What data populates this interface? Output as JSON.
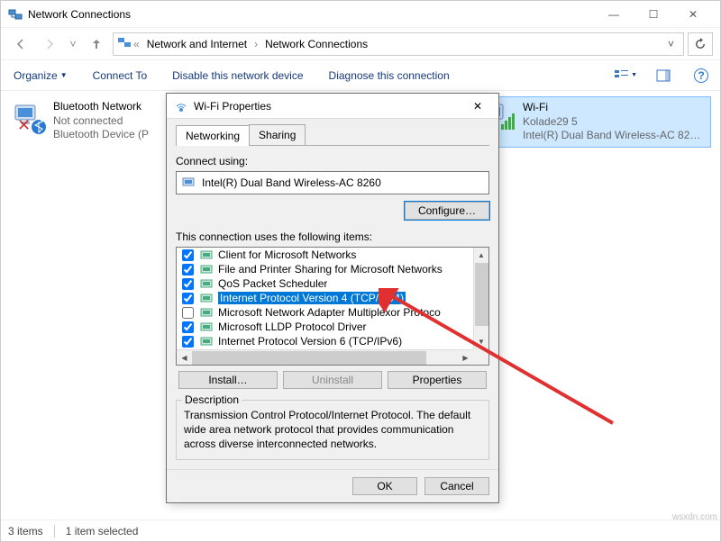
{
  "window": {
    "title": "Network Connections",
    "min": "—",
    "max": "☐",
    "close": "✕"
  },
  "breadcrumb": {
    "root_glyph": "«",
    "parent": "Network and Internet",
    "current": "Network Connections",
    "dropdown_glyph": "˅"
  },
  "toolbar": {
    "organize": "Organize",
    "connect_to": "Connect To",
    "disable": "Disable this network device",
    "diagnose": "Diagnose this connection",
    "help_glyph": "?"
  },
  "net_items": [
    {
      "name": "Bluetooth Network",
      "status": "Not connected",
      "device": "Bluetooth Device (P"
    },
    {
      "name": "Wi-Fi",
      "status": "Kolade29 5",
      "device": "Intel(R) Dual Band Wireless-AC 82…"
    }
  ],
  "statusbar": {
    "count": "3 items",
    "selected": "1 item selected"
  },
  "dialog": {
    "title": "Wi-Fi Properties",
    "close": "✕",
    "tabs": {
      "networking": "Networking",
      "sharing": "Sharing"
    },
    "connect_using_label": "Connect using:",
    "adapter": "Intel(R) Dual Band Wireless-AC 8260",
    "configure": "Configure…",
    "items_label": "This connection uses the following items:",
    "items": [
      {
        "checked": true,
        "label": "Client for Microsoft Networks"
      },
      {
        "checked": true,
        "label": "File and Printer Sharing for Microsoft Networks"
      },
      {
        "checked": true,
        "label": "QoS Packet Scheduler"
      },
      {
        "checked": true,
        "label": "Internet Protocol Version 4 (TCP/IPv4)",
        "selected": true
      },
      {
        "checked": false,
        "label": "Microsoft Network Adapter Multiplexor Protoco"
      },
      {
        "checked": true,
        "label": "Microsoft LLDP Protocol Driver"
      },
      {
        "checked": true,
        "label": "Internet Protocol Version 6 (TCP/IPv6)"
      }
    ],
    "install": "Install…",
    "uninstall": "Uninstall",
    "properties": "Properties",
    "desc_legend": "Description",
    "desc_text": "Transmission Control Protocol/Internet Protocol. The default wide area network protocol that provides communication across diverse interconnected networks.",
    "ok": "OK",
    "cancel": "Cancel"
  },
  "watermark": "wsxdn.com"
}
